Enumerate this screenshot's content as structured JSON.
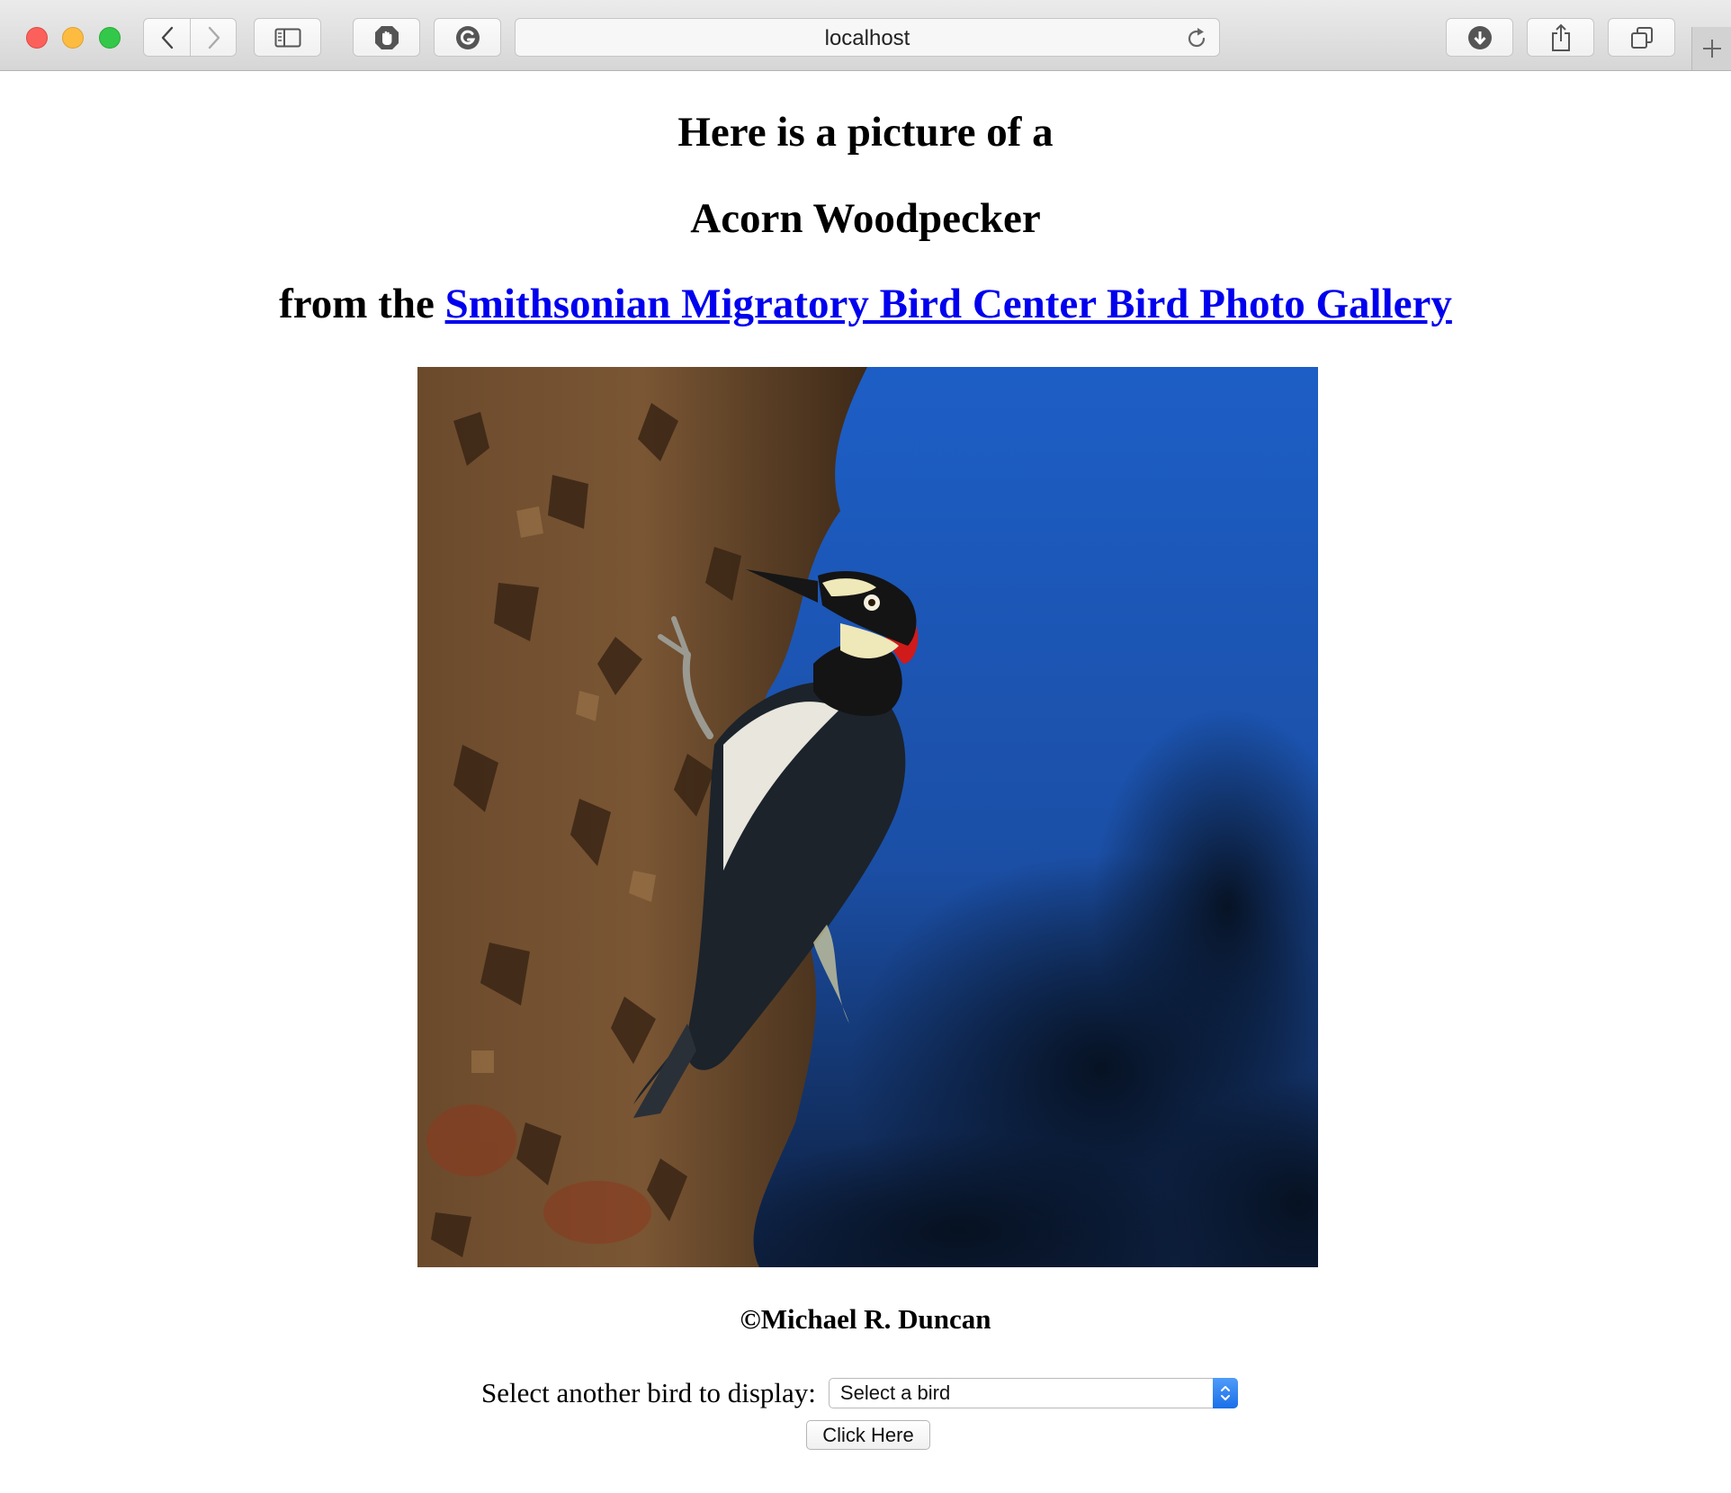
{
  "browser": {
    "url": "localhost",
    "icons": [
      "back-icon",
      "forward-icon",
      "sidebar-icon",
      "shield-icon",
      "grammarly-icon",
      "reload-icon",
      "download-icon",
      "share-icon",
      "tabs-icon",
      "plus-icon"
    ]
  },
  "page": {
    "heading_line1": "Here is a picture of a",
    "bird_name": "Acorn Woodpecker",
    "heading_line3_prefix": "from the ",
    "gallery_link_text": "Smithsonian Migratory Bird Center Bird Photo Gallery",
    "photo_credit": "©Michael R. Duncan",
    "select_label": "Select another bird to display:",
    "select_value": "Select a bird",
    "submit_label": "Click Here"
  },
  "colors": {
    "link": "#0000ee",
    "sky": "#1e5ec4",
    "select_arrow": "#2d7ff0"
  }
}
